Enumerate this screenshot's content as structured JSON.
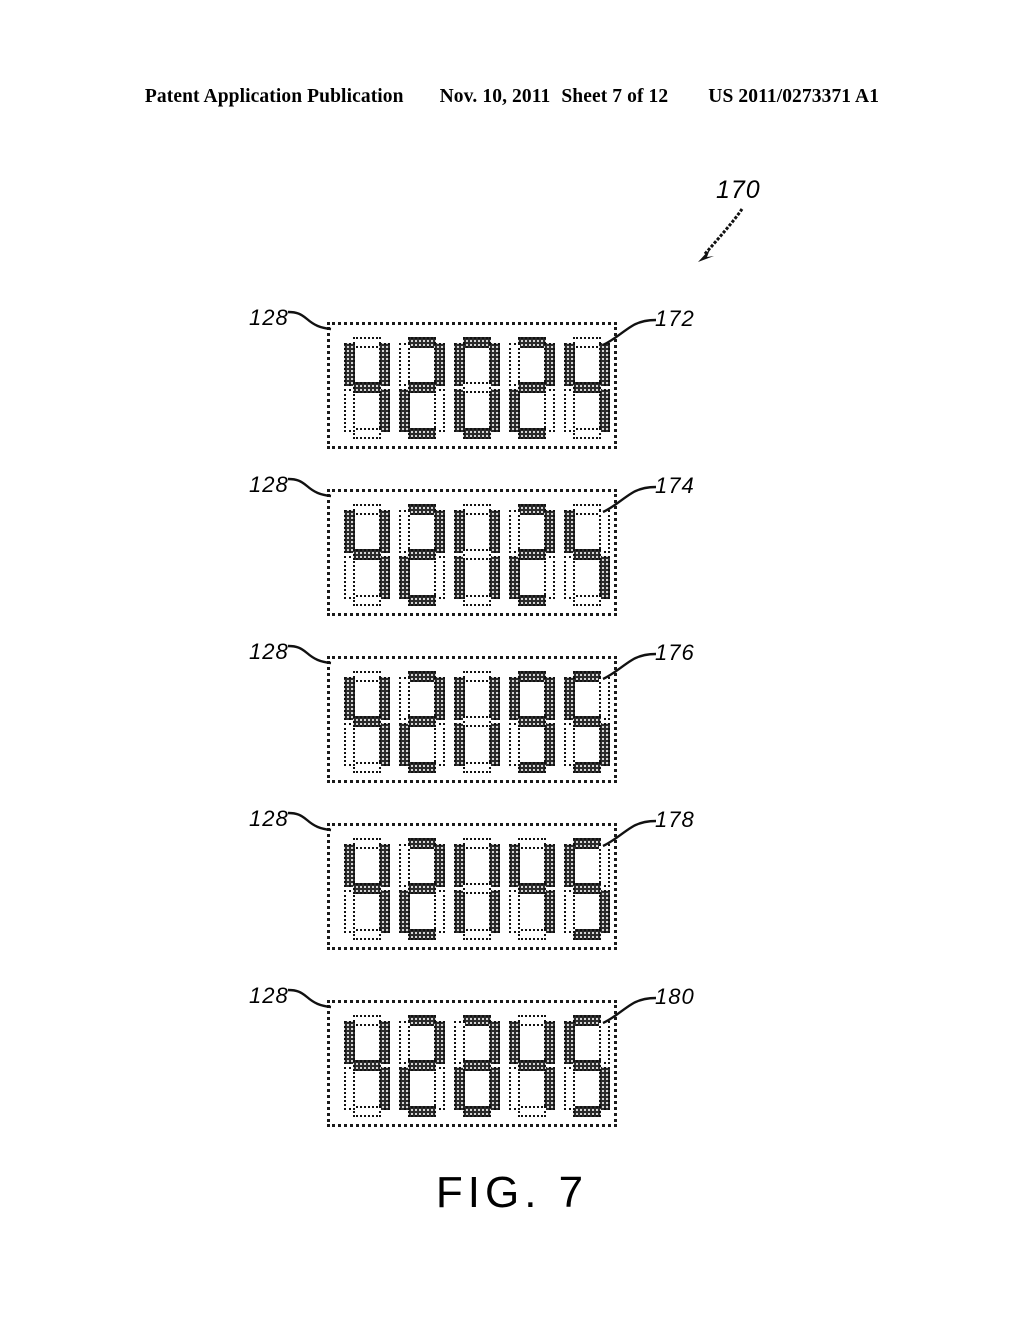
{
  "header": {
    "publication": "Patent Application Publication",
    "date": "Nov. 10, 2011",
    "sheet": "Sheet 7 of 12",
    "publication_number": "US 2011/0273371 A1"
  },
  "figure": {
    "caption": "FIG. 7",
    "assembly_label": "170",
    "colors": {
      "ink": "#111111",
      "segment_fill": "#2b2b2b",
      "background": "#ffffff"
    },
    "segment_order": [
      "a",
      "b",
      "c",
      "d",
      "e",
      "f",
      "g"
    ],
    "modules": [
      {
        "ref": "172",
        "module_ref": "128",
        "digits": [
          {
            "a": 0,
            "b": 1,
            "c": 1,
            "d": 0,
            "e": 0,
            "f": 1,
            "g": 1
          },
          {
            "a": 1,
            "b": 1,
            "c": 0,
            "d": 1,
            "e": 1,
            "f": 0,
            "g": 1
          },
          {
            "a": 1,
            "b": 1,
            "c": 1,
            "d": 1,
            "e": 1,
            "f": 1,
            "g": 0
          },
          {
            "a": 1,
            "b": 1,
            "c": 0,
            "d": 1,
            "e": 1,
            "f": 0,
            "g": 1
          },
          {
            "a": 0,
            "b": 1,
            "c": 1,
            "d": 0,
            "e": 0,
            "f": 1,
            "g": 1
          }
        ]
      },
      {
        "ref": "174",
        "module_ref": "128",
        "digits": [
          {
            "a": 0,
            "b": 1,
            "c": 1,
            "d": 0,
            "e": 0,
            "f": 1,
            "g": 1
          },
          {
            "a": 1,
            "b": 1,
            "c": 0,
            "d": 1,
            "e": 1,
            "f": 0,
            "g": 1
          },
          {
            "a": 0,
            "b": 1,
            "c": 1,
            "d": 0,
            "e": 1,
            "f": 1,
            "g": 0
          },
          {
            "a": 1,
            "b": 1,
            "c": 0,
            "d": 1,
            "e": 1,
            "f": 0,
            "g": 1
          },
          {
            "a": 0,
            "b": 0,
            "c": 1,
            "d": 0,
            "e": 0,
            "f": 1,
            "g": 1
          }
        ]
      },
      {
        "ref": "176",
        "module_ref": "128",
        "digits": [
          {
            "a": 0,
            "b": 1,
            "c": 1,
            "d": 0,
            "e": 0,
            "f": 1,
            "g": 1
          },
          {
            "a": 1,
            "b": 1,
            "c": 0,
            "d": 1,
            "e": 1,
            "f": 0,
            "g": 1
          },
          {
            "a": 0,
            "b": 1,
            "c": 1,
            "d": 0,
            "e": 1,
            "f": 1,
            "g": 0
          },
          {
            "a": 1,
            "b": 1,
            "c": 1,
            "d": 1,
            "e": 0,
            "f": 1,
            "g": 1
          },
          {
            "a": 1,
            "b": 0,
            "c": 1,
            "d": 1,
            "e": 0,
            "f": 1,
            "g": 1
          }
        ]
      },
      {
        "ref": "178",
        "module_ref": "128",
        "digits": [
          {
            "a": 0,
            "b": 1,
            "c": 1,
            "d": 0,
            "e": 0,
            "f": 1,
            "g": 1
          },
          {
            "a": 1,
            "b": 1,
            "c": 0,
            "d": 1,
            "e": 1,
            "f": 0,
            "g": 1
          },
          {
            "a": 0,
            "b": 1,
            "c": 1,
            "d": 0,
            "e": 1,
            "f": 1,
            "g": 0
          },
          {
            "a": 0,
            "b": 1,
            "c": 1,
            "d": 0,
            "e": 0,
            "f": 1,
            "g": 1
          },
          {
            "a": 1,
            "b": 0,
            "c": 1,
            "d": 1,
            "e": 0,
            "f": 1,
            "g": 1
          }
        ]
      },
      {
        "ref": "180",
        "module_ref": "128",
        "digits": [
          {
            "a": 0,
            "b": 1,
            "c": 1,
            "d": 0,
            "e": 0,
            "f": 1,
            "g": 1
          },
          {
            "a": 1,
            "b": 1,
            "c": 0,
            "d": 1,
            "e": 1,
            "f": 0,
            "g": 1
          },
          {
            "a": 1,
            "b": 1,
            "c": 1,
            "d": 1,
            "e": 1,
            "f": 0,
            "g": 1
          },
          {
            "a": 0,
            "b": 1,
            "c": 1,
            "d": 0,
            "e": 0,
            "f": 1,
            "g": 1
          },
          {
            "a": 1,
            "b": 0,
            "c": 1,
            "d": 1,
            "e": 0,
            "f": 1,
            "g": 1
          }
        ]
      }
    ]
  }
}
